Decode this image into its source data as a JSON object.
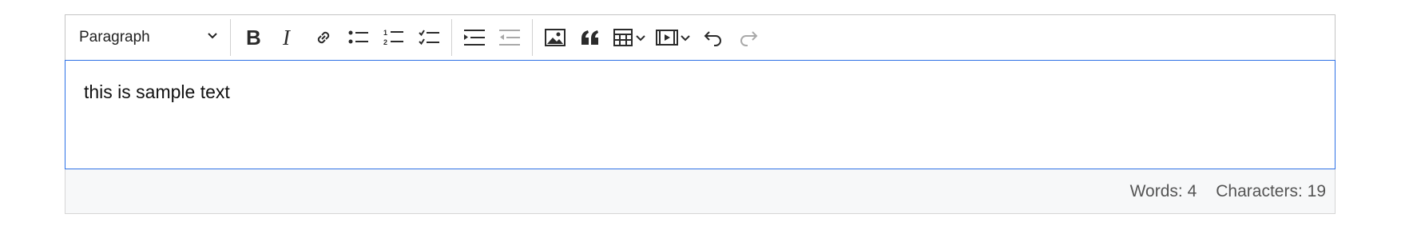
{
  "toolbar": {
    "heading_select": {
      "value": "Paragraph"
    },
    "buttons": {
      "bold": "bold-icon",
      "italic": "italic-icon",
      "link": "link-icon",
      "bulleted_list": "bulleted-list-icon",
      "numbered_list": "numbered-list-icon",
      "todo_list": "todo-list-icon",
      "indent": "indent-icon",
      "outdent": "outdent-icon",
      "image": "image-icon",
      "block_quote": "quote-icon",
      "table": "table-icon",
      "media": "media-icon",
      "undo": "undo-icon",
      "redo": "redo-icon"
    },
    "disabled": [
      "outdent",
      "redo"
    ]
  },
  "editor": {
    "content": "this is sample text"
  },
  "status": {
    "words_label": "Words: 4",
    "characters_label": "Characters: 19"
  },
  "colors": {
    "focus_border": "#2f72e6",
    "status_bg": "#f7f8f9",
    "icon": "#2b2b2b",
    "icon_disabled": "#a9a9a9"
  }
}
